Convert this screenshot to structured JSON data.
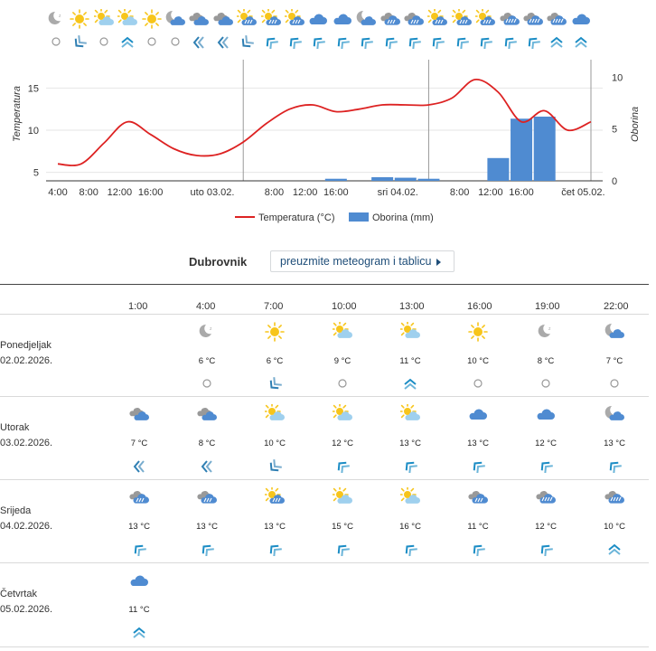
{
  "strip": {
    "icons": [
      "moon-clear",
      "sun",
      "sun-cloud",
      "sun-cloud",
      "sun",
      "moon-cloud",
      "cloud-dark",
      "cloud-dark",
      "sun-cloud-rain",
      "sun-cloud-rain",
      "sun-cloud-rain",
      "cloud",
      "cloud",
      "moon-cloud",
      "cloud-rain",
      "cloud-rain",
      "sun-cloud-rain",
      "sun-cloud-rain",
      "sun-cloud-rain",
      "cloud-heavy-rain",
      "cloud-heavy-rain",
      "cloud-heavy-rain",
      "cloud"
    ],
    "winds": [
      "calm",
      "sw",
      "calm",
      "north",
      "calm",
      "calm",
      "west",
      "west",
      "sw",
      "nw",
      "nw",
      "nw",
      "nw",
      "nw",
      "nw",
      "nw",
      "nw",
      "nw",
      "nw",
      "nw",
      "nw",
      "north",
      "north"
    ]
  },
  "chart_data": {
    "type": "line",
    "ylabel": "Temperatura",
    "y2label": "Oborina",
    "ylim": [
      4,
      17.5
    ],
    "y2lim": [
      0,
      11
    ],
    "yticks": [
      "5",
      "10",
      "15"
    ],
    "y2ticks": [
      "0",
      "5",
      "10"
    ],
    "x_hours": [
      0,
      3,
      6,
      9,
      12,
      15,
      18,
      21,
      24,
      27,
      30,
      33,
      36,
      39,
      42,
      45,
      48,
      51,
      54,
      57,
      60,
      63,
      66,
      69
    ],
    "xticks": [
      "4:00",
      "8:00",
      "12:00",
      "16:00",
      "uto 03.02.",
      "8:00",
      "12:00",
      "16:00",
      "sri 04.02.",
      "8:00",
      "12:00",
      "16:00",
      "čet 05.02."
    ],
    "series": [
      {
        "name": "Temperatura (°C)",
        "type": "line",
        "color": "#dd2222",
        "values": [
          6,
          6,
          8.5,
          11,
          9.5,
          7.8,
          7,
          7.2,
          8.6,
          10.8,
          12.5,
          13,
          12.2,
          12.5,
          13,
          13,
          13,
          13.8,
          16,
          14.5,
          11,
          12.3,
          10,
          11
        ]
      },
      {
        "name": "Oborina (mm)",
        "type": "bar",
        "color": "#4f8bd1",
        "values": [
          0,
          0,
          0,
          0,
          0,
          0,
          0,
          0,
          0,
          0,
          0,
          0,
          0.2,
          0,
          0.35,
          0.3,
          0.2,
          0,
          0,
          2.2,
          6,
          6.2,
          0,
          0
        ]
      }
    ],
    "legend": "bottom"
  },
  "location": "Dubrovnik",
  "download_label": "preuzmite meteogram i tablicu",
  "table": {
    "hours": [
      "1:00",
      "4:00",
      "7:00",
      "10:00",
      "13:00",
      "16:00",
      "19:00",
      "22:00"
    ],
    "days": [
      {
        "name": "Ponedjeljak",
        "date": "02.02.2026.",
        "cells": [
          null,
          {
            "icon": "moon-clear",
            "temp": "6 °C",
            "wind": "calm"
          },
          {
            "icon": "sun",
            "temp": "6 °C",
            "wind": "sw"
          },
          {
            "icon": "sun-cloud",
            "temp": "9 °C",
            "wind": "calm"
          },
          {
            "icon": "sun-cloud",
            "temp": "11 °C",
            "wind": "north"
          },
          {
            "icon": "sun",
            "temp": "10 °C",
            "wind": "calm"
          },
          {
            "icon": "moon-clear",
            "temp": "8 °C",
            "wind": "calm"
          },
          {
            "icon": "moon-cloud",
            "temp": "7 °C",
            "wind": "calm"
          }
        ]
      },
      {
        "name": "Utorak",
        "date": "03.02.2026.",
        "cells": [
          {
            "icon": "cloud-dark",
            "temp": "7 °C",
            "wind": "west"
          },
          {
            "icon": "cloud-dark",
            "temp": "8 °C",
            "wind": "west"
          },
          {
            "icon": "sun-cloud",
            "temp": "10 °C",
            "wind": "sw"
          },
          {
            "icon": "sun-cloud",
            "temp": "12 °C",
            "wind": "nw"
          },
          {
            "icon": "sun-cloud",
            "temp": "13 °C",
            "wind": "nw"
          },
          {
            "icon": "cloud",
            "temp": "13 °C",
            "wind": "nw"
          },
          {
            "icon": "cloud",
            "temp": "12 °C",
            "wind": "nw"
          },
          {
            "icon": "moon-cloud",
            "temp": "13 °C",
            "wind": "nw"
          }
        ]
      },
      {
        "name": "Srijeda",
        "date": "04.02.2026.",
        "cells": [
          {
            "icon": "cloud-rain",
            "temp": "13 °C",
            "wind": "nw"
          },
          {
            "icon": "cloud-rain",
            "temp": "13 °C",
            "wind": "nw"
          },
          {
            "icon": "sun-cloud-rain",
            "temp": "13 °C",
            "wind": "nw"
          },
          {
            "icon": "sun-cloud",
            "temp": "15 °C",
            "wind": "nw"
          },
          {
            "icon": "sun-cloud",
            "temp": "16 °C",
            "wind": "nw"
          },
          {
            "icon": "cloud-rain",
            "temp": "11 °C",
            "wind": "nw"
          },
          {
            "icon": "cloud-heavy-rain",
            "temp": "12 °C",
            "wind": "nw"
          },
          {
            "icon": "cloud-heavy-rain",
            "temp": "10 °C",
            "wind": "north"
          }
        ]
      },
      {
        "name": "Četvrtak",
        "date": "05.02.2026.",
        "cells": [
          {
            "icon": "cloud",
            "temp": "11 °C",
            "wind": "north"
          },
          null,
          null,
          null,
          null,
          null,
          null,
          null
        ]
      }
    ]
  },
  "colors": {
    "temp_line": "#dd2222",
    "precip_bar": "#4f8bd1",
    "sun": "#f7c51b",
    "cloud": "#4f8bd1",
    "wind": "#1c8dc5",
    "calm": "#999999"
  }
}
